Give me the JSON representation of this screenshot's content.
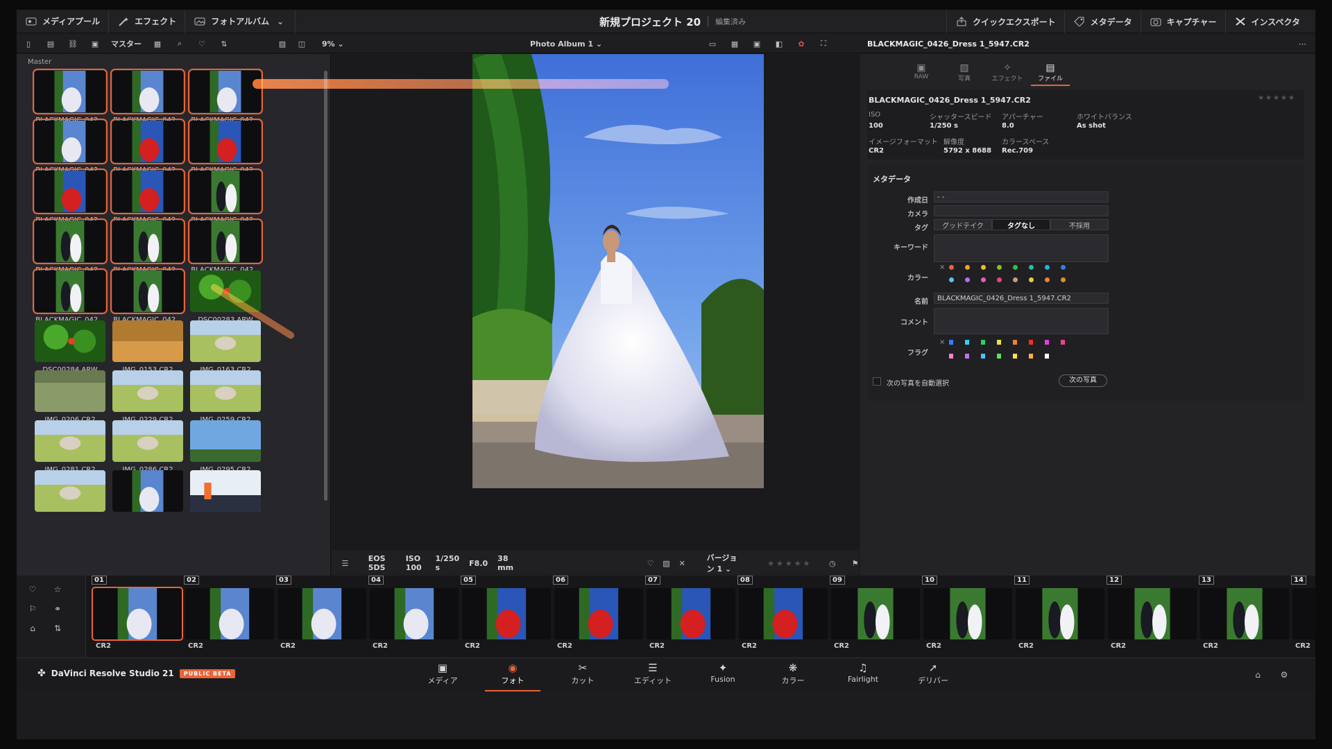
{
  "topbar": {
    "media_pool": "メディアプール",
    "effects": "エフェクト",
    "photo_album": "フォトアルバム",
    "project_title": "新規プロジェクト 20",
    "project_status": "編集済み",
    "quick_export": "クイックエクスポート",
    "metadata": "メタデータ",
    "capture": "キャプチャー",
    "inspector": "インスペクタ"
  },
  "toolbar2": {
    "master_label": "マスター",
    "zoom": "9%",
    "album_select": "Photo Album 1",
    "clip_filename": "BLACKMAGIC_0426_Dress 1_5947.CR2"
  },
  "media_pool": {
    "bin": "Master",
    "items": [
      {
        "name": "BLACKMAGIC_042...",
        "kind": "bw-dress",
        "selected": true
      },
      {
        "name": "BLACKMAGIC_042...",
        "kind": "bw-dress",
        "selected": true
      },
      {
        "name": "BLACKMAGIC_042...",
        "kind": "bw-dress",
        "selected": true
      },
      {
        "name": "BLACKMAGIC_042...",
        "kind": "bw-dress",
        "selected": true
      },
      {
        "name": "BLACKMAGIC_042...",
        "kind": "red-dress",
        "selected": true
      },
      {
        "name": "BLACKMAGIC_042...",
        "kind": "red-dress",
        "selected": true
      },
      {
        "name": "BLACKMAGIC_042...",
        "kind": "red-dress",
        "selected": true
      },
      {
        "name": "BLACKMAGIC_042...",
        "kind": "red-dress",
        "selected": true
      },
      {
        "name": "BLACKMAGIC_042...",
        "kind": "couple",
        "selected": true
      },
      {
        "name": "BLACKMAGIC_042...",
        "kind": "couple",
        "selected": true
      },
      {
        "name": "BLACKMAGIC_042...",
        "kind": "couple",
        "selected": true
      },
      {
        "name": "BLACKMAGIC_042...",
        "kind": "couple",
        "selected": true
      },
      {
        "name": "BLACKMAGIC_042...",
        "kind": "couple",
        "selected": true
      },
      {
        "name": "BLACKMAGIC_042...",
        "kind": "couple",
        "selected": true
      },
      {
        "name": "DSC00283.ARW",
        "kind": "leaves",
        "selected": false
      },
      {
        "name": "DSC00284.ARW",
        "kind": "leaves",
        "selected": false
      },
      {
        "name": "IMG_0153.CR2",
        "kind": "sand",
        "selected": false
      },
      {
        "name": "IMG_0163.CR2",
        "kind": "field",
        "selected": false
      },
      {
        "name": "IMG_0206.CR2",
        "kind": "grass",
        "selected": false
      },
      {
        "name": "IMG_0229.CR2",
        "kind": "field",
        "selected": false
      },
      {
        "name": "IMG_0259.CR2",
        "kind": "field",
        "selected": false
      },
      {
        "name": "IMG_0281.CR2",
        "kind": "field",
        "selected": false
      },
      {
        "name": "IMG_0286.CR2",
        "kind": "field",
        "selected": false
      },
      {
        "name": "IMG_0295.CR2",
        "kind": "sky",
        "selected": false
      },
      {
        "name": "",
        "kind": "field",
        "selected": false
      },
      {
        "name": "",
        "kind": "bw-dress",
        "selected": false
      },
      {
        "name": "",
        "kind": "studio",
        "selected": false
      }
    ]
  },
  "viewer_bar": {
    "camera": "EOS 5DS",
    "iso": "ISO 100",
    "shutter": "1/250 s",
    "aperture": "F8.0",
    "focal": "38 mm",
    "version": "バージョン 1"
  },
  "inspector": {
    "tabs": [
      "RAW",
      "写真",
      "エフェクト",
      "ファイル"
    ],
    "active_tab": "ファイル",
    "filename": "BLACKMAGIC_0426_Dress 1_5947.CR2",
    "iso_label": "ISO",
    "iso": "100",
    "shutter_label": "シャッタースピード",
    "shutter": "1/250 s",
    "aperture_label": "アパーチャー",
    "aperture": "8.0",
    "wb_label": "ホワイトバランス",
    "wb": "As shot",
    "format_label": "イメージフォーマット",
    "format": "CR2",
    "resolution_label": "解像度",
    "resolution": "5792 x 8688",
    "colorspace_label": "カラースペース",
    "colorspace": "Rec.709",
    "metadata_heading": "メタデータ",
    "created_label": "作成日",
    "created": "- -",
    "camera_label": "カメラ",
    "camera": "",
    "tag_label": "タグ",
    "tag_good": "グッドテイク",
    "tag_none": "タグなし",
    "tag_reject": "不採用",
    "keyword_label": "キーワード",
    "color_label": "カラー",
    "name_label": "名前",
    "name": "BLACKMAGIC_0426_Dress 1_5947.CR2",
    "comment_label": "コメント",
    "flag_label": "フラグ",
    "auto_select": "次の写真を自動選択",
    "next_photo": "次の写真",
    "clear_mark": "×",
    "color_dots": [
      "#e8643a",
      "#f0a020",
      "#e8c020",
      "#8ac020",
      "#30c040",
      "#20c0a0",
      "#20b0e0",
      "#3080e0",
      "#60c0f0",
      "#b070f0",
      "#e060c0",
      "#f04080",
      "#c0a080",
      "#e0d040",
      "#f08030",
      "#e09020"
    ],
    "flag_colors": [
      "#3080ff",
      "#30d0f0",
      "#30d060",
      "#f0e040",
      "#f08030",
      "#f03030",
      "#e040e0",
      "#f04090",
      "#ff80c0",
      "#c070f0",
      "#50c0ff",
      "#60e060",
      "#ffe050",
      "#ffb040",
      "#ffffff"
    ]
  },
  "filmstrip": [
    {
      "num": "01",
      "cap": "CR2",
      "kind": "bw-dress",
      "selected": true
    },
    {
      "num": "02",
      "cap": "CR2",
      "kind": "bw-dress"
    },
    {
      "num": "03",
      "cap": "CR2",
      "kind": "bw-dress"
    },
    {
      "num": "04",
      "cap": "CR2",
      "kind": "bw-dress"
    },
    {
      "num": "05",
      "cap": "CR2",
      "kind": "red-dress"
    },
    {
      "num": "06",
      "cap": "CR2",
      "kind": "red-dress"
    },
    {
      "num": "07",
      "cap": "CR2",
      "kind": "red-dress"
    },
    {
      "num": "08",
      "cap": "CR2",
      "kind": "red-dress"
    },
    {
      "num": "09",
      "cap": "CR2",
      "kind": "couple"
    },
    {
      "num": "10",
      "cap": "CR2",
      "kind": "couple"
    },
    {
      "num": "11",
      "cap": "CR2",
      "kind": "couple"
    },
    {
      "num": "12",
      "cap": "CR2",
      "kind": "couple"
    },
    {
      "num": "13",
      "cap": "CR2",
      "kind": "couple"
    },
    {
      "num": "14",
      "cap": "CR2",
      "kind": "couple"
    }
  ],
  "bottom_nav": {
    "brand": "DaVinci Resolve Studio 21",
    "beta": "PUBLIC BETA",
    "pages": [
      {
        "label": "メディア",
        "icon": "media-icon"
      },
      {
        "label": "フォト",
        "icon": "photo-icon",
        "active": true
      },
      {
        "label": "カット",
        "icon": "cut-icon"
      },
      {
        "label": "エディット",
        "icon": "edit-icon"
      },
      {
        "label": "Fusion",
        "icon": "fusion-icon"
      },
      {
        "label": "カラー",
        "icon": "color-icon"
      },
      {
        "label": "Fairlight",
        "icon": "fairlight-icon"
      },
      {
        "label": "デリバー",
        "icon": "deliver-icon"
      }
    ]
  },
  "colors": {
    "accent": "#e8643a",
    "panel": "#27272b",
    "background": "#1c1c1e"
  }
}
